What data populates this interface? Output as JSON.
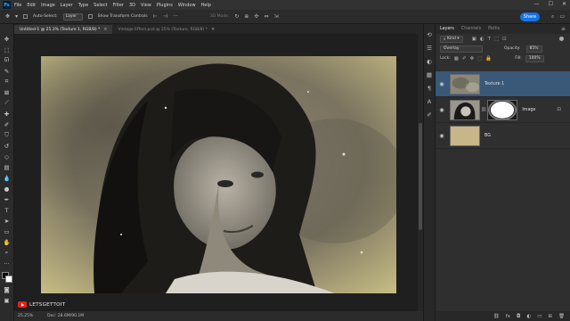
{
  "menubar": {
    "logo": "Ps",
    "items": [
      "File",
      "Edit",
      "Image",
      "Layer",
      "Type",
      "Select",
      "Filter",
      "3D",
      "View",
      "Plugins",
      "Window",
      "Help"
    ],
    "window_controls": [
      "—",
      "☐",
      "✕"
    ]
  },
  "options_bar": {
    "auto_select_label": "Auto-Select:",
    "auto_select_target": "Layer",
    "show_transform_label": "Show Transform Controls",
    "mode_3d_label": "3D Mode:",
    "share_label": "Share"
  },
  "tabs": [
    {
      "label": "Untitled-1 @ 25.3% (Texture 1, RGB/8) *",
      "active": true
    },
    {
      "label": "Vintage Effect.psd @ 25% (Texture, RGB/8) *",
      "active": false
    }
  ],
  "statusbar": {
    "zoom": "25.25%",
    "doc": "Doc: 28.6M/90.1M"
  },
  "watermark": {
    "text": "LETSGETTOIT"
  },
  "panel": {
    "tabs": [
      "Layers",
      "Channels",
      "Paths"
    ],
    "kind_filter": "Kind",
    "blend_mode": "Overlay",
    "opacity_label": "Opacity:",
    "opacity_value": "85%",
    "lock_label": "Lock:",
    "fill_label": "Fill:",
    "fill_value": "100%",
    "layers": [
      {
        "name": "Texture 1",
        "visible": true,
        "selected": true
      },
      {
        "name": "Image",
        "visible": true,
        "selected": false,
        "has_mask": true
      },
      {
        "name": "BG",
        "visible": true,
        "selected": false
      }
    ]
  },
  "colors": {
    "accent": "#1473e6",
    "selected_layer": "#3a5878",
    "bg_swatch": "#c9b58a"
  }
}
